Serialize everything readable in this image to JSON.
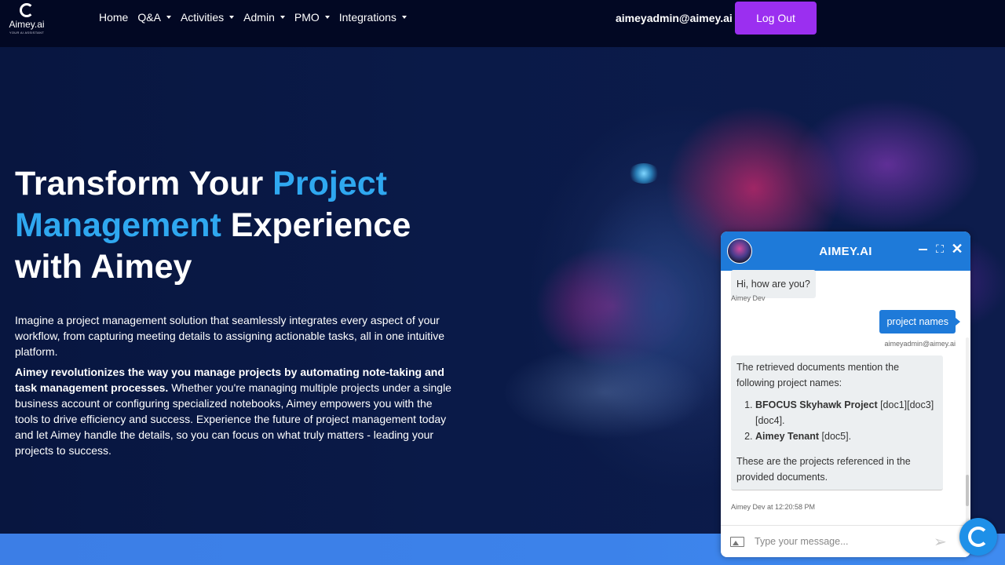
{
  "logo": {
    "name": "Aimey.ai",
    "tagline": "YOUR AI ASSISTANT",
    "icon": "aimey-logo-icon"
  },
  "nav": {
    "items": [
      {
        "label": "Home",
        "dropdown": false
      },
      {
        "label": "Q&A",
        "dropdown": true
      },
      {
        "label": "Activities",
        "dropdown": true
      },
      {
        "label": "Admin",
        "dropdown": true
      },
      {
        "label": "PMO",
        "dropdown": true
      },
      {
        "label": "Integrations",
        "dropdown": true
      }
    ],
    "user_email": "aimeyadmin@aimey.ai",
    "logout_label": "Log Out"
  },
  "hero": {
    "title_part1": "Transform Your ",
    "title_highlight": "Project Management",
    "title_part2": " Experience with Aimey",
    "para1": "Imagine a project management solution that seamlessly integrates every aspect of your workflow, from capturing meeting details to assigning actionable tasks, all in one intuitive platform.",
    "para2_bold": "Aimey revolutionizes the way you manage projects by automating note-taking and task management processes.",
    "para2_rest": " Whether you're managing multiple projects under a single business account or configuring specialized notebooks, Aimey empowers you with the tools to drive efficiency and success. Experience the future of project management today and let Aimey handle the details, so you can focus on what truly matters - leading your projects to success."
  },
  "chat": {
    "title": "AIMEY.AI",
    "messages": {
      "greeting": "Hi, how are you?",
      "greeting_sender": "Aimey Dev",
      "user_message": "project names",
      "user_sender": "aimeyadmin@aimey.ai",
      "reply_intro": "The retrieved documents mention the following project names:",
      "reply_items": [
        {
          "name": "BFOCUS Skyhawk Project",
          "refs": " [doc1][doc3][doc4]."
        },
        {
          "name": "Aimey Tenant",
          "refs": " [doc5]."
        }
      ],
      "reply_outro": "These are the projects referenced in the provided documents.",
      "reply_sender": "Aimey Dev at 12:20:58 PM"
    },
    "input_placeholder": "Type your message..."
  },
  "colors": {
    "accent_blue": "#1e7ad9",
    "highlight": "#2fa8f0",
    "logout_purple": "#9b2ff0"
  }
}
